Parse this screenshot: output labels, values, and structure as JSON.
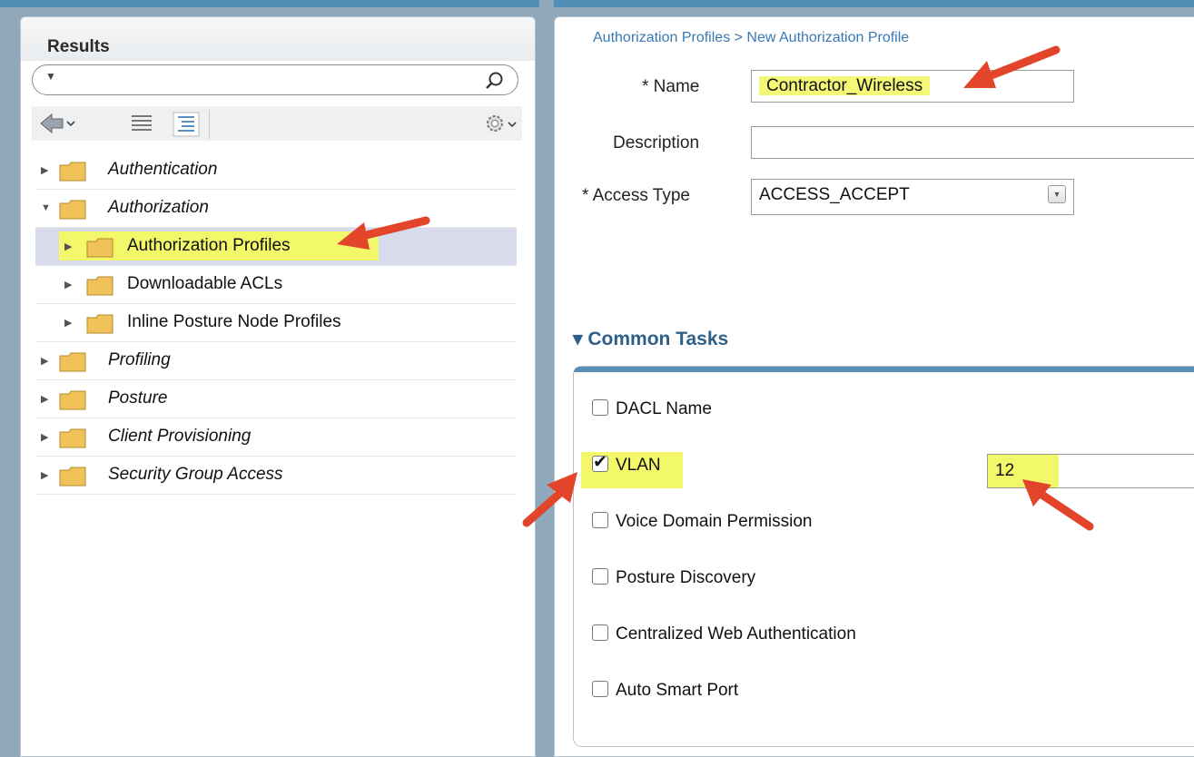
{
  "left": {
    "title": "Results",
    "search": {
      "placeholder": ""
    },
    "tree": [
      {
        "label": "Authentication",
        "level": 0,
        "italic": true
      },
      {
        "label": "Authorization",
        "level": 0,
        "italic": true,
        "expanded": true
      },
      {
        "label": "Authorization Profiles",
        "level": 1,
        "selected": true
      },
      {
        "label": "Downloadable ACLs",
        "level": 1
      },
      {
        "label": "Inline Posture Node Profiles",
        "level": 1
      },
      {
        "label": "Profiling",
        "level": 0,
        "italic": true
      },
      {
        "label": "Posture",
        "level": 0,
        "italic": true
      },
      {
        "label": "Client Provisioning",
        "level": 0,
        "italic": true
      },
      {
        "label": "Security Group Access",
        "level": 0,
        "italic": true
      }
    ]
  },
  "right": {
    "breadcrumb": "Authorization Profiles > New Authorization Profile",
    "name_label": "* Name",
    "name_value": "Contractor_Wireless",
    "description_label": "Description",
    "description_value": "",
    "access_type_label": "* Access Type",
    "access_type_value": "ACCESS_ACCEPT",
    "common_tasks_title": "▾ Common Tasks",
    "tasks": [
      {
        "label": "DACL Name",
        "checked": false
      },
      {
        "label": "VLAN",
        "checked": true
      },
      {
        "label": "Voice Domain Permission",
        "checked": false
      },
      {
        "label": "Posture Discovery",
        "checked": false
      },
      {
        "label": "Centralized Web Authentication",
        "checked": false
      },
      {
        "label": "Auto Smart Port",
        "checked": false
      }
    ],
    "vlan_value": "12"
  },
  "colors": {
    "highlight": "#f3f76a",
    "link": "#3a78b4",
    "section": "#2e5f88",
    "arrow": "#e2452a"
  }
}
